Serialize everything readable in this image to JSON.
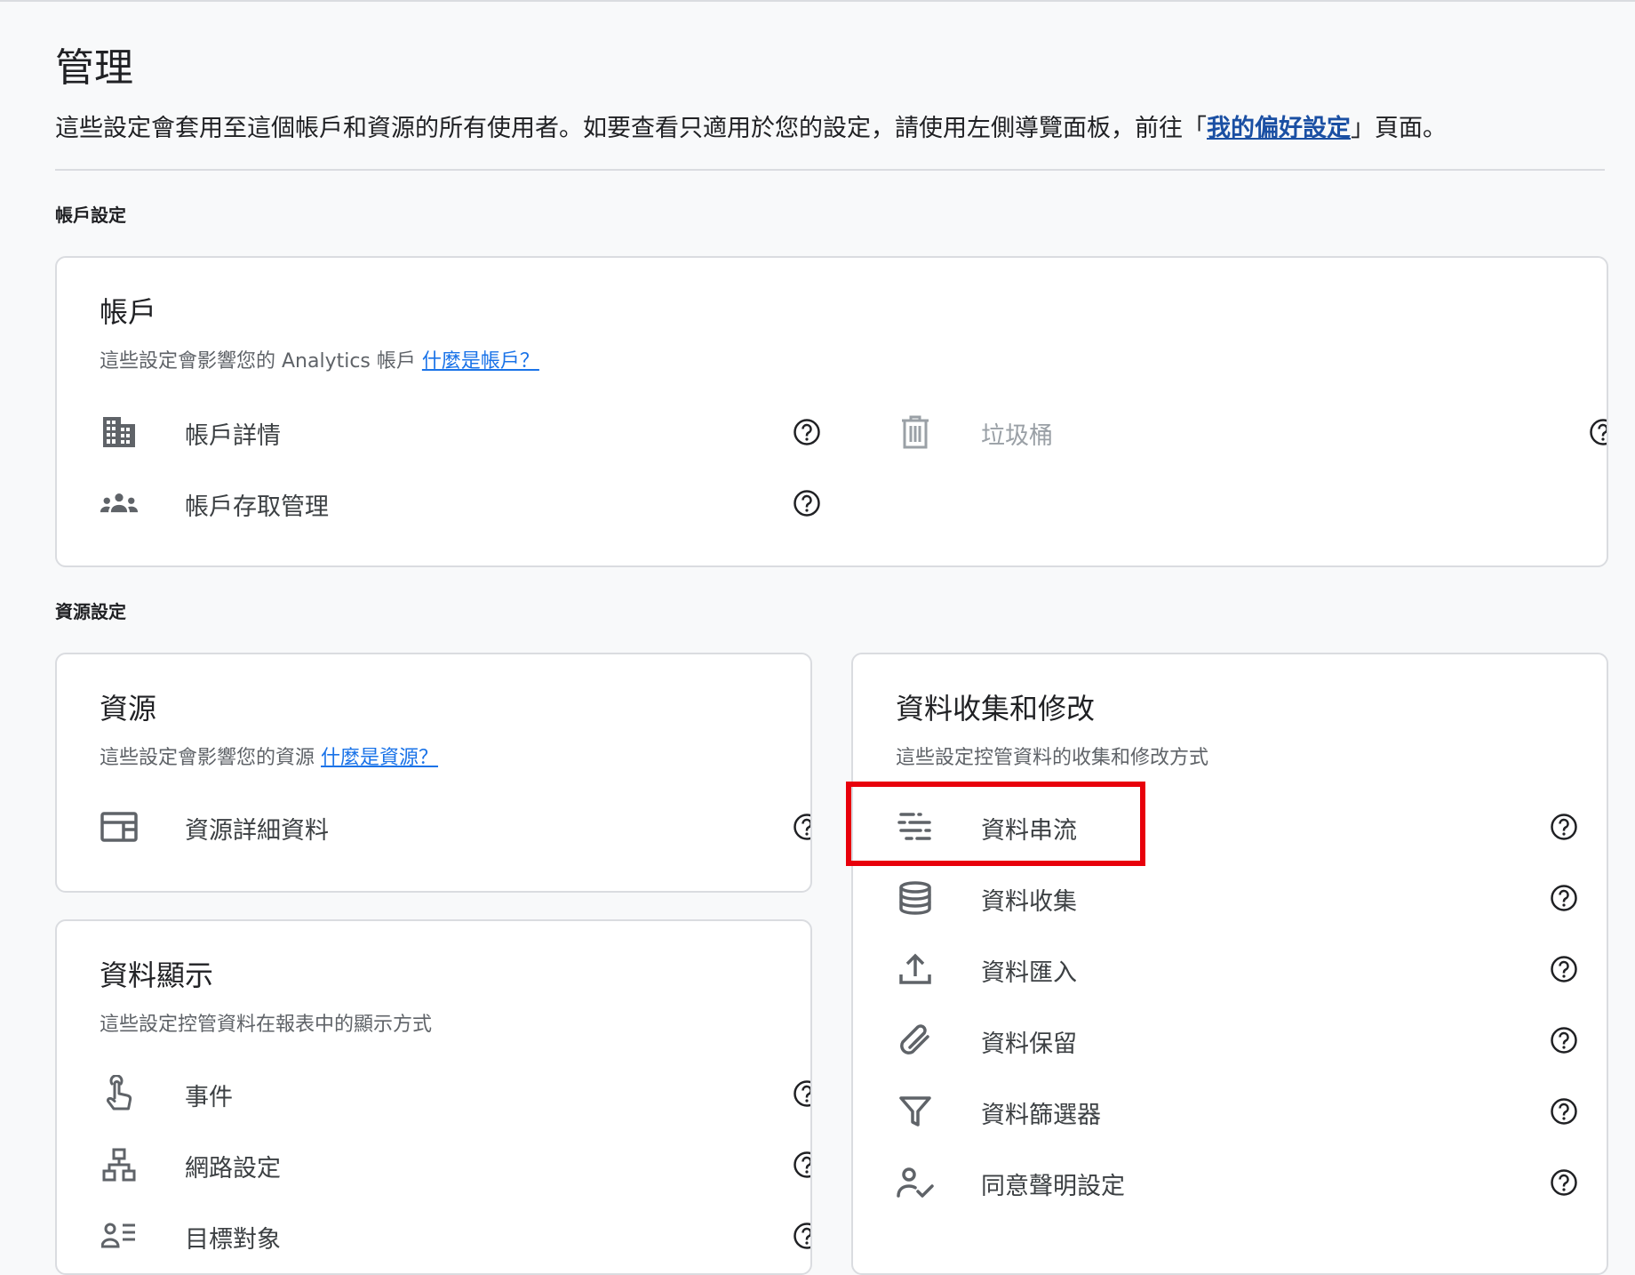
{
  "page": {
    "title": "管理",
    "intro_text": "這些設定會套用至這個帳戶和資源的所有使用者。如要查看只適用於您的設定，請使用左側導覽面板，前往「",
    "intro_link": "我的偏好設定",
    "intro_suffix": "」頁面。"
  },
  "sections": {
    "account_settings_label": "帳戶設定",
    "property_settings_label": "資源設定"
  },
  "account_card": {
    "title": "帳戶",
    "desc": "這些設定會影響您的 Analytics 帳戶 ",
    "desc_link": "什麼是帳戶？",
    "items": [
      {
        "label": "帳戶詳情",
        "icon": "building-icon"
      },
      {
        "label": "帳戶存取管理",
        "icon": "group-icon"
      },
      {
        "label": "垃圾桶",
        "icon": "trash-icon",
        "disabled": true
      }
    ]
  },
  "property_card": {
    "title": "資源",
    "desc": "這些設定會影響您的資源 ",
    "desc_link": "什麼是資源？",
    "items": [
      {
        "label": "資源詳細資料",
        "icon": "property-details-icon"
      }
    ]
  },
  "data_display_card": {
    "title": "資料顯示",
    "desc": "這些設定控管資料在報表中的顯示方式",
    "items": [
      {
        "label": "事件",
        "icon": "touch-icon"
      },
      {
        "label": "網路設定",
        "icon": "network-icon"
      },
      {
        "label": "目標對象",
        "icon": "audience-icon"
      }
    ]
  },
  "data_collection_card": {
    "title": "資料收集和修改",
    "desc": "這些設定控管資料的收集和修改方式",
    "items": [
      {
        "label": "資料串流",
        "icon": "data-streams-icon"
      },
      {
        "label": "資料收集",
        "icon": "database-icon"
      },
      {
        "label": "資料匯入",
        "icon": "upload-icon"
      },
      {
        "label": "資料保留",
        "icon": "attachment-icon"
      },
      {
        "label": "資料篩選器",
        "icon": "filter-icon"
      },
      {
        "label": "同意聲明設定",
        "icon": "consent-icon"
      }
    ]
  },
  "colors": {
    "link": "#1a73e8",
    "highlight": "#e8000b",
    "icon": "#5f6368",
    "disabled": "#9aa0a6"
  }
}
